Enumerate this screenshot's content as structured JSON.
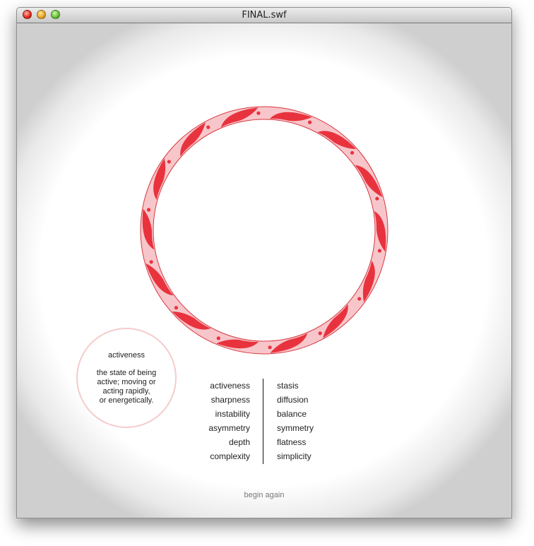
{
  "window": {
    "title": "FINAL.swf",
    "controls": [
      "close",
      "minimize",
      "zoom"
    ]
  },
  "ring": {
    "colors": {
      "band": "#f7c6ca",
      "accent": "#e8333e",
      "outline": "#d8383f"
    },
    "dot_count": 14,
    "wave_count": 14
  },
  "definition": {
    "word": "activeness",
    "lines": [
      "the state of being",
      "active; moving or",
      "acting rapidly,",
      "or energetically."
    ]
  },
  "pairs": {
    "left": [
      "activeness",
      "sharpness",
      "instability",
      "asymmetry",
      "depth",
      "complexity"
    ],
    "right": [
      "stasis",
      "diffusion",
      "balance",
      "symmetry",
      "flatness",
      "simplicity"
    ]
  },
  "begin_again": "begin again"
}
